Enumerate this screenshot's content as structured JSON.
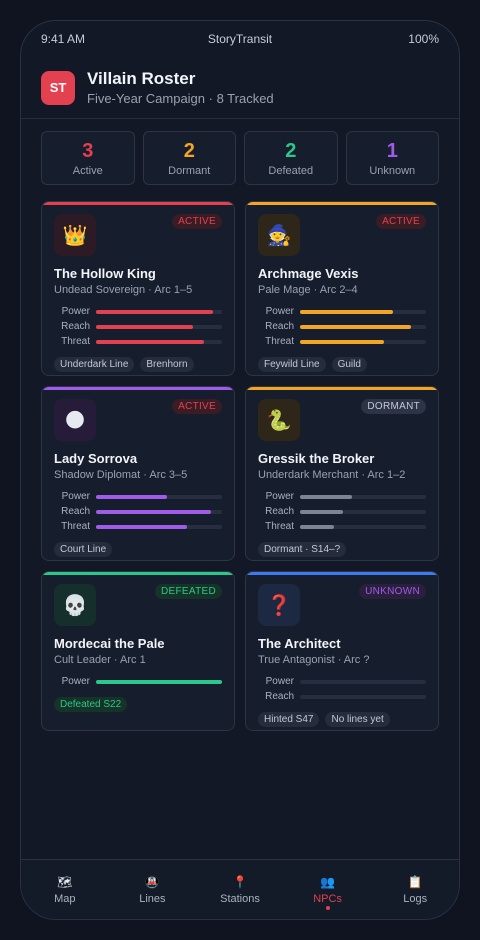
{
  "status_bar": {
    "time": "9:41 AM",
    "app": "StoryTransit",
    "battery": "100%"
  },
  "header": {
    "logo_text": "ST",
    "title": "Villain Roster",
    "subtitle": "Five-Year Campaign · 8 Tracked"
  },
  "stats": [
    {
      "value": "3",
      "label": "Active",
      "color": "#e34050"
    },
    {
      "value": "2",
      "label": "Dormant",
      "color": "#f2a623"
    },
    {
      "value": "2",
      "label": "Defeated",
      "color": "#2cc78a"
    },
    {
      "value": "1",
      "label": "Unknown",
      "color": "#a05be8"
    }
  ],
  "colors": {
    "active": "#e34050",
    "dormant": "#f2a623",
    "defeated": "#2cc78a",
    "unknown": "#a05be8",
    "blue": "#3c7cf0",
    "grey_bar": "#7d8494"
  },
  "villains": [
    {
      "icon": "crown-icon",
      "emoji": "👑",
      "name": "The Hollow King",
      "role": "Undead Sovereign · Arc 1–5",
      "status": "ACTIVE",
      "bars": [
        {
          "label": "Power",
          "value": 0.93
        },
        {
          "label": "Reach",
          "value": 0.77
        },
        {
          "label": "Threat",
          "value": 0.86
        }
      ],
      "tags": [
        "Underdark Line",
        "Brenhorn"
      ]
    },
    {
      "icon": "mage-icon",
      "emoji": "🧙",
      "name": "Archmage Vexis",
      "role": "Pale Mage · Arc 2–4",
      "status": "ACTIVE",
      "bars": [
        {
          "label": "Power",
          "value": 0.74
        },
        {
          "label": "Reach",
          "value": 0.88
        },
        {
          "label": "Threat",
          "value": 0.67
        }
      ],
      "tags": [
        "Feywild Line",
        "Guild"
      ]
    },
    {
      "icon": "shadow-orb-icon",
      "emoji": "🌑",
      "name": "Lady Sorrova",
      "role": "Shadow Diplomat · Arc 3–5",
      "status": "ACTIVE",
      "bars": [
        {
          "label": "Power",
          "value": 0.56
        },
        {
          "label": "Reach",
          "value": 0.91
        },
        {
          "label": "Threat",
          "value": 0.72
        }
      ],
      "tags": [
        "Court Line"
      ]
    },
    {
      "icon": "snake-icon",
      "emoji": "🐍",
      "name": "Gressik the Broker",
      "role": "Underdark Merchant · Arc 1–2",
      "status": "DORMANT",
      "bars": [
        {
          "label": "Power",
          "value": 0.41
        },
        {
          "label": "Reach",
          "value": 0.34
        },
        {
          "label": "Threat",
          "value": 0.27
        }
      ],
      "tags": [
        "Dormant · S14–?"
      ]
    },
    {
      "icon": "skull-icon",
      "emoji": "💀",
      "name": "Mordecai the Pale",
      "role": "Cult Leader · Arc 1",
      "status": "DEFEATED",
      "bars": [
        {
          "label": "Power",
          "value": 1.0
        }
      ],
      "tags": [
        "Defeated S22"
      ]
    },
    {
      "icon": "question-icon",
      "emoji": "❓",
      "name": "The Architect",
      "role": "True Antagonist · Arc ?",
      "status": "UNKNOWN",
      "bars": [
        {
          "label": "Power",
          "value": 0.0
        },
        {
          "label": "Reach",
          "value": 0.0
        }
      ],
      "tags": [
        "Hinted S47",
        "No lines yet"
      ]
    }
  ],
  "tabs": [
    {
      "icon": "map-icon",
      "glyph": "🗺",
      "label": "Map",
      "active": false
    },
    {
      "icon": "train-icon",
      "glyph": "🚇",
      "label": "Lines",
      "active": false
    },
    {
      "icon": "pin-icon",
      "glyph": "📍",
      "label": "Stations",
      "active": false
    },
    {
      "icon": "people-icon",
      "glyph": "👥",
      "label": "NPCs",
      "active": true
    },
    {
      "icon": "clipboard-icon",
      "glyph": "📋",
      "label": "Logs",
      "active": false
    }
  ]
}
